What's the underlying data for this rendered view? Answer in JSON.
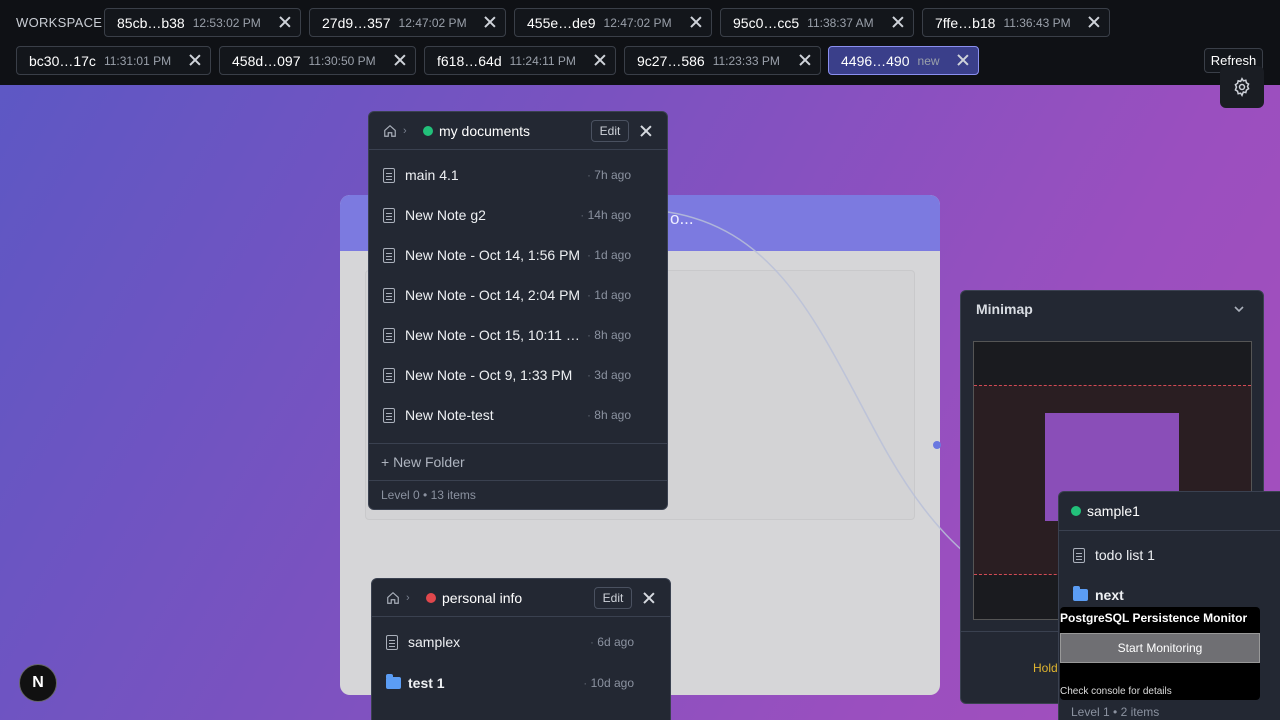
{
  "workspace_label": "WORKSPACE",
  "tabs_row1": [
    {
      "id": "85cb…b38",
      "time": "12:53:02 PM"
    },
    {
      "id": "27d9…357",
      "time": "12:47:02 PM"
    },
    {
      "id": "455e…de9",
      "time": "12:47:02 PM"
    },
    {
      "id": "95c0…cc5",
      "time": "11:38:37 AM"
    },
    {
      "id": "7ffe…b18",
      "time": "11:36:43 PM"
    }
  ],
  "tabs_row2": [
    {
      "id": "bc30…17c",
      "time": "11:31:01 PM"
    },
    {
      "id": "458d…097",
      "time": "11:30:50 PM"
    },
    {
      "id": "f618…64d",
      "time": "11:24:11 PM"
    },
    {
      "id": "9c27…586",
      "time": "11:23:33 PM"
    },
    {
      "id": "4496…490",
      "time": "new"
    }
  ],
  "refresh_label": "Refresh",
  "bg_card_title": "o...",
  "docs_panel": {
    "title": "my documents",
    "status_color": "#22c07a",
    "edit_label": "Edit",
    "items": [
      {
        "name": "main 4.1",
        "time": "7h ago"
      },
      {
        "name": "New Note g2",
        "time": "14h ago"
      },
      {
        "name": "New Note - Oct 14, 1:56 PM",
        "time": "1d ago"
      },
      {
        "name": "New Note - Oct 14, 2:04 PM",
        "time": "1d ago"
      },
      {
        "name": "New Note - Oct 15, 10:11 …",
        "time": "8h ago"
      },
      {
        "name": "New Note - Oct 9, 1:33 PM",
        "time": "3d ago"
      },
      {
        "name": "New Note-test",
        "time": "8h ago"
      }
    ],
    "new_folder": "+ New Folder",
    "level_info": "Level 0 • 13 items"
  },
  "personal_panel": {
    "title": "personal info",
    "status_color": "#e0474c",
    "edit_label": "Edit",
    "items": [
      {
        "name": "samplex",
        "time": "6d ago",
        "type": "doc"
      },
      {
        "name": "test 1",
        "time": "10d ago",
        "type": "folder"
      }
    ]
  },
  "minimap": {
    "title": "Minimap",
    "hold_text": "Hold"
  },
  "sample_panel": {
    "title": "sample1",
    "status_color": "#22c07a",
    "items": [
      {
        "name": "todo list 1",
        "type": "doc"
      },
      {
        "name": "next",
        "type": "folder"
      }
    ],
    "level_info": "Level 1 • 2 items"
  },
  "pg_monitor": {
    "title": "PostgreSQL Persistence Monitor",
    "button": "Start Monitoring",
    "note": "Check console for details"
  },
  "logo_letter": "N"
}
